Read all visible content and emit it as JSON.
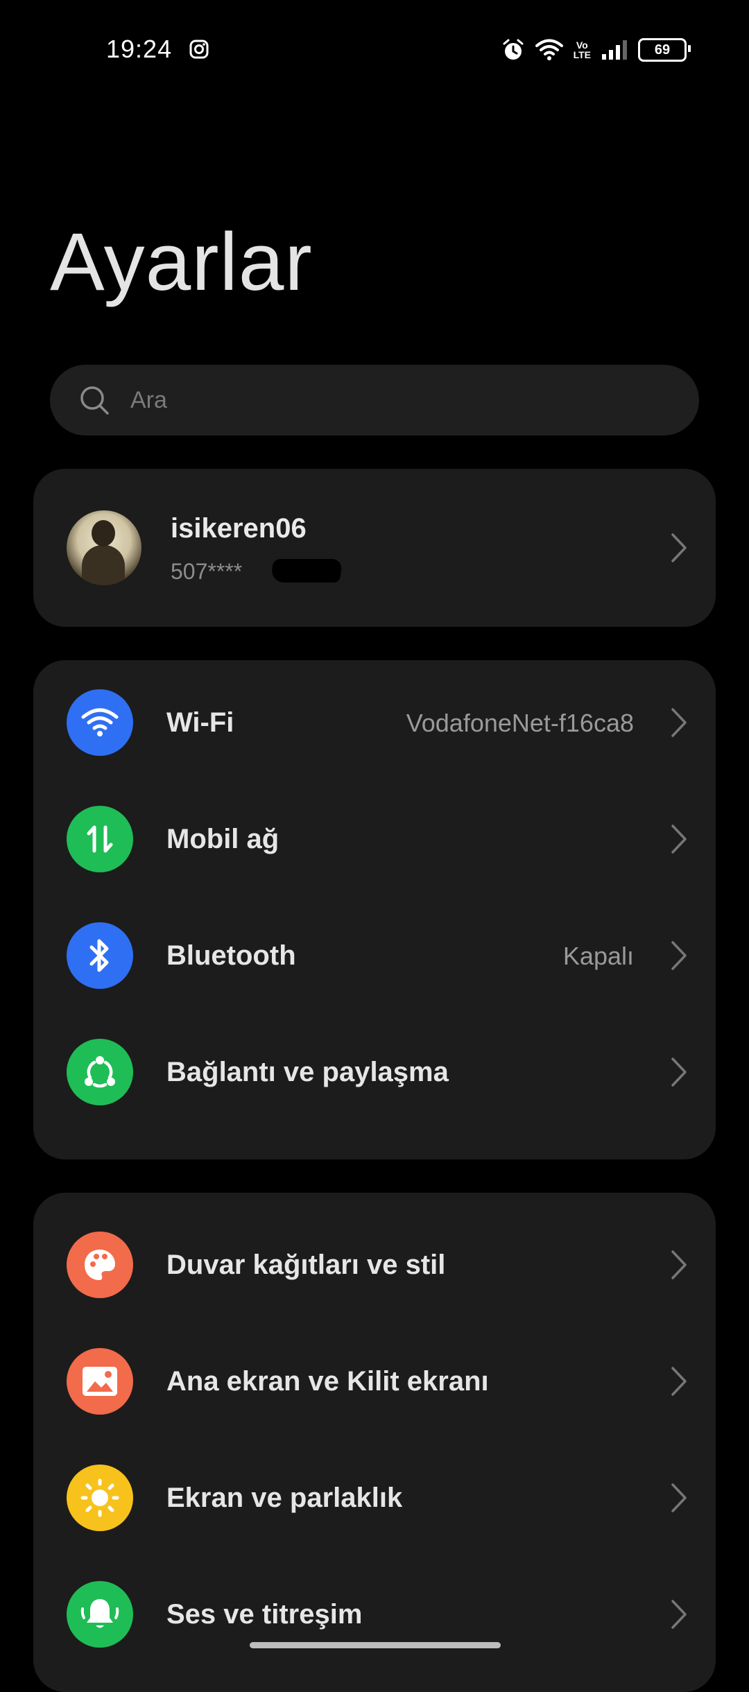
{
  "status_bar": {
    "time": "19:24",
    "battery": "69",
    "volte_top": "Vo",
    "volte_bottom": "LTE"
  },
  "page": {
    "title": "Ayarlar"
  },
  "search": {
    "placeholder": "Ara"
  },
  "profile": {
    "name": "isikeren06",
    "phone": "507****"
  },
  "network_group": [
    {
      "label": "Wi-Fi",
      "value": "VodafoneNet-f16ca8",
      "icon": "wifi-icon",
      "color": "#2f6ff3"
    },
    {
      "label": "Mobil ağ",
      "value": "",
      "icon": "mobile-data-icon",
      "color": "#1fbd56"
    },
    {
      "label": "Bluetooth",
      "value": "Kapalı",
      "icon": "bluetooth-icon",
      "color": "#2f6ff3"
    },
    {
      "label": "Bağlantı ve paylaşma",
      "value": "",
      "icon": "share-icon",
      "color": "#1fbd56"
    }
  ],
  "personalization_group": [
    {
      "label": "Duvar kağıtları ve stil",
      "icon": "palette-icon",
      "color": "#f26b4b"
    },
    {
      "label": "Ana ekran ve Kilit ekranı",
      "icon": "image-icon",
      "color": "#f26b4b"
    },
    {
      "label": "Ekran ve parlaklık",
      "icon": "sun-icon",
      "color": "#f7c21b"
    },
    {
      "label": "Ses ve titreşim",
      "icon": "bell-icon",
      "color": "#1fbd56"
    }
  ]
}
